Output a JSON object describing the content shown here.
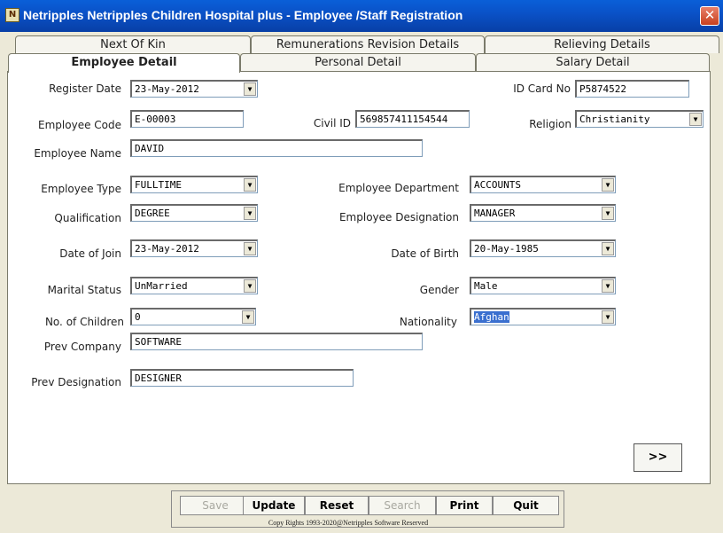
{
  "window": {
    "title": "Netripples Netripples Children Hospital plus - Employee /Staff Registration",
    "close": "✕",
    "icon": "app-icon"
  },
  "tabs_back": [
    "Next Of Kin",
    "Remunerations Revision Details",
    "Relieving Details"
  ],
  "tabs_front": [
    "Employee Detail",
    "Personal Detail",
    "Salary Detail"
  ],
  "labels": {
    "register_date": "Register Date",
    "id_card_no": "ID Card No",
    "employee_code": "Employee Code",
    "civil_id": "Civil ID",
    "religion": "Religion",
    "employee_name": "Employee Name",
    "employee_type": "Employee Type",
    "employee_department": "Employee Department",
    "qualification": "Qualification",
    "employee_designation": "Employee Designation",
    "date_of_join": "Date of Join",
    "date_of_birth": "Date of Birth",
    "marital_status": "Marital Status",
    "gender": "Gender",
    "no_of_children": "No. of Children",
    "nationality": "Nationality",
    "prev_company": "Prev Company",
    "prev_designation": "Prev Designation"
  },
  "values": {
    "register_date": "23-May-2012",
    "id_card_no": "P5874522",
    "employee_code": "E-00003",
    "civil_id": "569857411154544",
    "religion": "Christianity",
    "employee_name": "DAVID",
    "employee_type": "FULLTIME",
    "employee_department": "ACCOUNTS",
    "qualification": "DEGREE",
    "employee_designation": "MANAGER",
    "date_of_join": "23-May-2012",
    "date_of_birth": "20-May-1985",
    "marital_status": "UnMarried",
    "gender": "Male",
    "no_of_children": "0",
    "nationality": "Afghan",
    "prev_company": "SOFTWARE",
    "prev_designation": "DESIGNER"
  },
  "next_button": ">>",
  "buttons": {
    "save": "Save",
    "update": "Update",
    "reset": "Reset",
    "search": "Search",
    "print": "Print",
    "quit": "Quit"
  },
  "copyright": "Copy Rights 1993-2020@Netripples Software Reserved",
  "dropdown_arrow": "▼"
}
